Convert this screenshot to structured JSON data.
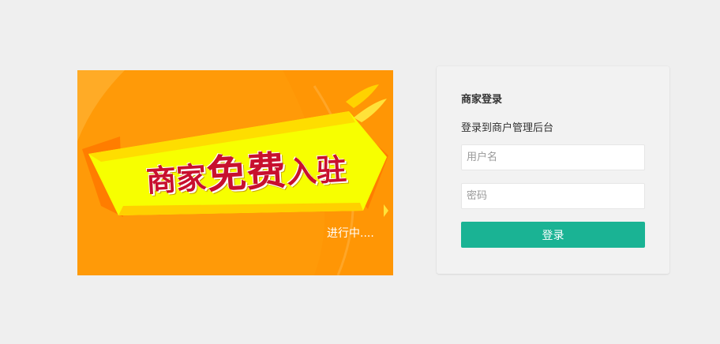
{
  "banner": {
    "headline_part1": "商家",
    "headline_part2": "免费",
    "headline_part3": "入驻",
    "status": "进行中...."
  },
  "login": {
    "title": "商家登录",
    "subtitle": "登录到商户管理后台",
    "username_placeholder": "用户名",
    "password_placeholder": "密码",
    "submit_label": "登录"
  },
  "colors": {
    "page_bg": "#efefef",
    "banner_orange": "#ff9a08",
    "ribbon_yellow": "#f7ff00",
    "headline_red": "#c8102e",
    "button_green": "#1ab394"
  }
}
